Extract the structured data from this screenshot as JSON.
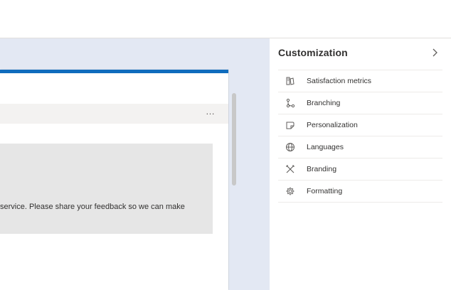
{
  "card": {
    "more_label": "…",
    "body_text": "service. Please share your feedback so we can make"
  },
  "panel": {
    "title": "Customization",
    "items": [
      {
        "label": "Satisfaction metrics",
        "icon": "satisfaction-metrics-icon"
      },
      {
        "label": "Branching",
        "icon": "branching-icon"
      },
      {
        "label": "Personalization",
        "icon": "personalization-icon"
      },
      {
        "label": "Languages",
        "icon": "globe-icon"
      },
      {
        "label": "Branding",
        "icon": "branding-icon"
      },
      {
        "label": "Formatting",
        "icon": "gear-icon"
      }
    ]
  },
  "colors": {
    "accent": "#0f6cbd",
    "canvas": "#e3e8f3",
    "card_body": "#e6e6e6"
  }
}
